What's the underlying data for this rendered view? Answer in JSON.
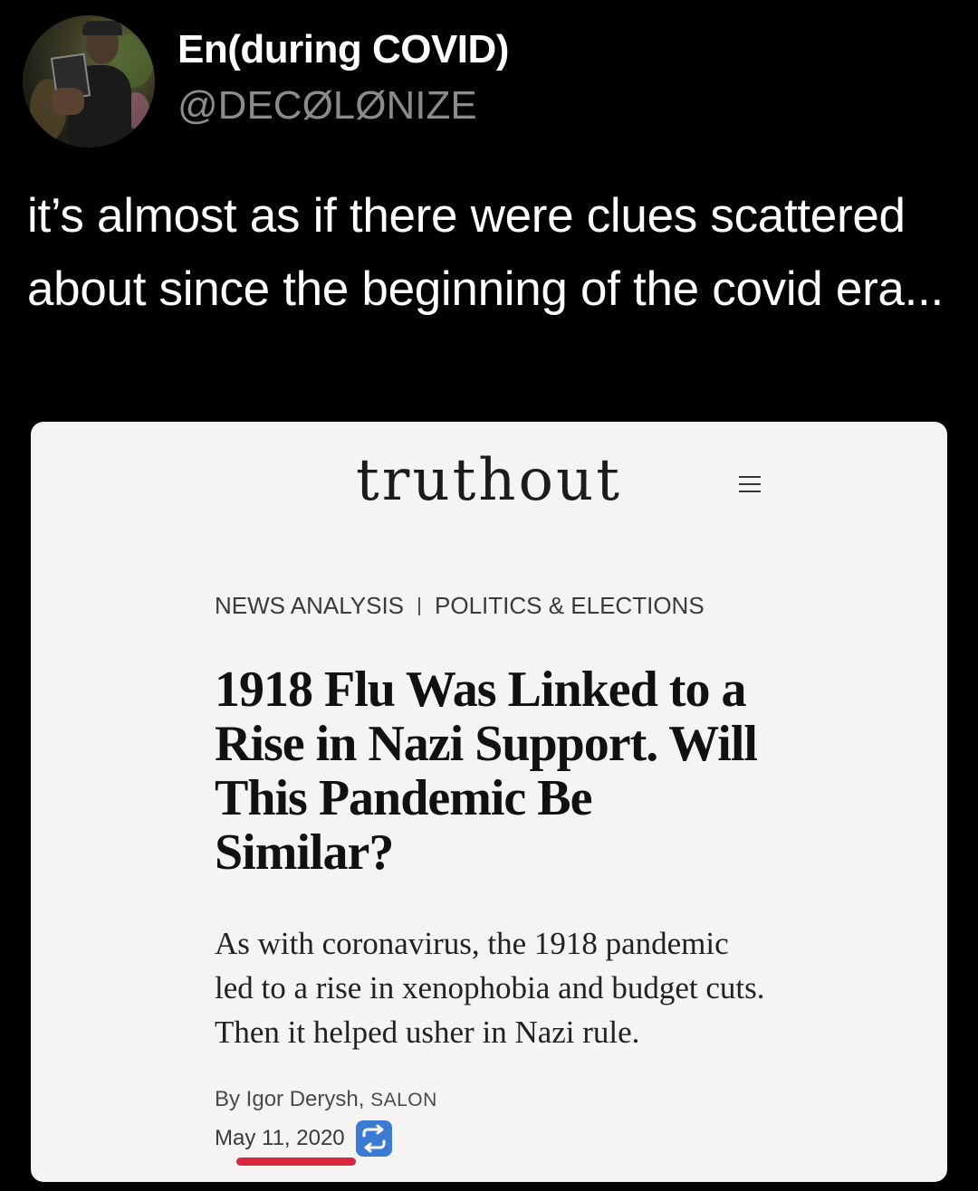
{
  "tweet": {
    "display_name": "En(during COVID)",
    "handle": "@DECØLØNIZE",
    "text": "it’s almost as if there were clues scattered about since the beginning of the covid era..."
  },
  "article_card": {
    "site_logo": "truthout",
    "menu_icon": "hamburger-menu-icon",
    "category_1": "NEWS ANALYSIS",
    "category_2": "POLITICS & ELECTIONS",
    "headline": "1918 Flu Was Linked to a Rise in Nazi Support. Will This Pandemic Be Similar?",
    "dek": "As with coronavirus, the 1918 pandemic led to a rise in xenophobia and budget cuts. Then it helped usher in Nazi rule.",
    "byline_prefix": "By Igor Derysh,",
    "byline_source": "SALON",
    "date": "May 11, 2020",
    "date_icon": "repost-icon",
    "highlight_color": "#d7263d",
    "icon_color": "#3b7bd4"
  }
}
